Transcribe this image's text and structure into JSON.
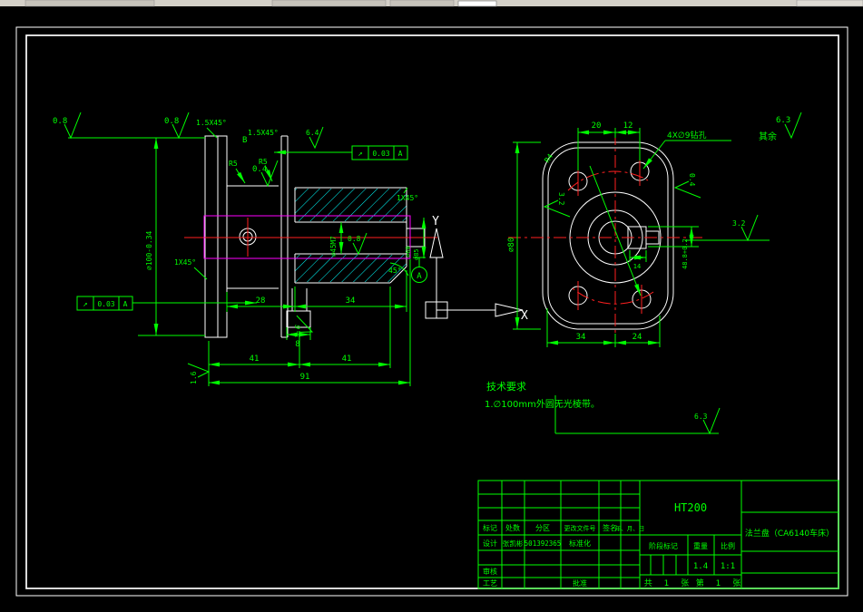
{
  "left_view": {
    "finish_top_a": "0.8",
    "finish_top_b": "0.8",
    "chamfer_top_left": "1.5X45°",
    "detail_label": "B",
    "chamfer_rim": "1.5X45°",
    "finish_rim": "6.4",
    "fillet_a": "R5",
    "fillet_b": "R5",
    "finish_web": "0.4",
    "runout_top": {
      "sym": "↗",
      "tol": "0.03",
      "datum": "A"
    },
    "runout_left": {
      "sym": "↗",
      "tol": "0.03",
      "datum": "A"
    },
    "chamfer_shaft": "1X45°",
    "chamfer_bore": "1X45°",
    "dia_outer": "∅100-0.34",
    "dia_bore": "∅45M7",
    "finish_bore": "0.8",
    "dia_end_a": "∅60",
    "dia_end_b": "∅85",
    "angle_chamfer": "45°",
    "datum_label": "A",
    "dim_28": "28",
    "dim_34": "34",
    "dim_8": "8",
    "finish_groove": "1.6",
    "finish_face": "1.6",
    "dim_41_a": "41",
    "dim_41_b": "41",
    "dim_91": "91"
  },
  "ucs": {
    "x_label": "X",
    "y_label": "Y"
  },
  "right_view": {
    "dim_20": "20",
    "dim_12": "12",
    "holes_note": "4X∅9钻孔",
    "fillet_r4": "R4",
    "finish_left": "3.2",
    "finish_right": "0.4",
    "finish_keyway": "3.2",
    "finish_bottom": "6.3",
    "dia_flange": "∅80",
    "keyway_depth": "48.8+0.2",
    "keyway_width": "14",
    "dim_34": "34",
    "dim_24": "24"
  },
  "general_finish": {
    "label": "其余",
    "value": "6.3"
  },
  "tech_requirements": {
    "title": "技术要求",
    "item_1": "1.∅100mm外圆无光棱带。"
  },
  "title_block": {
    "material": "HT200",
    "part_name": "法兰盘（CA6140车床）",
    "col_labels": [
      "标记",
      "处数",
      "分区",
      "更改文件号",
      "签名",
      "年、月、日"
    ],
    "design_label": "设计",
    "designer": "张凯彬",
    "design_no": "501392365",
    "standard_label": "标准化",
    "audit_label": "审核",
    "process_label": "工艺",
    "approve_label": "批准",
    "stage_label": "阶段标记",
    "weight_label": "重量",
    "scale_label": "比例",
    "weight_value": "1.4",
    "scale_value": "1:1",
    "sheet_total": "共 1 张",
    "sheet_no": "第 1 张"
  }
}
